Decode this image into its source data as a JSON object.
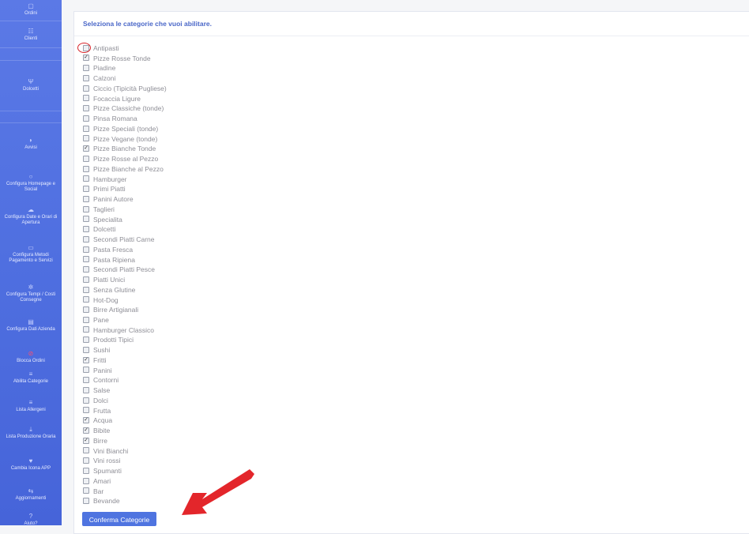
{
  "sidebar": {
    "items": [
      {
        "label": "Ordini",
        "icon": "box-icon"
      },
      {
        "label": "Clienti",
        "icon": "users-icon"
      },
      {
        "label": "Dolcetti",
        "icon": "fork-knife-icon"
      },
      {
        "label": "Avvisi",
        "icon": "megaphone-icon"
      },
      {
        "label": "Configura Homepage e Social",
        "icon": "chat-icon"
      },
      {
        "label": "Configura Date e Orari di Apertura",
        "icon": "cloud-icon"
      },
      {
        "label": "Configura Metodi Pagamento e Servizi",
        "icon": "card-icon"
      },
      {
        "label": "Configura Tempi / Costi Consegne",
        "icon": "gears-icon"
      },
      {
        "label": "Configura Dati Azienda",
        "icon": "building-icon"
      },
      {
        "label": "Blocca Ordini",
        "icon": "stop-icon",
        "color": "#ff4d6d"
      },
      {
        "label": "Abilita Categorie",
        "icon": "list-icon"
      },
      {
        "label": "Lista Allergeni",
        "icon": "list-icon"
      },
      {
        "label": "Lista Produzione Oraria",
        "icon": "download-icon"
      },
      {
        "label": "Cambia Icona APP",
        "icon": "heart-icon"
      },
      {
        "label": "Aggiornamenti",
        "icon": "refresh-icon"
      },
      {
        "label": "Aiuto?",
        "icon": "help-icon"
      }
    ]
  },
  "main": {
    "title": "Seleziona le categorie che vuoi abilitare.",
    "categories": [
      {
        "label": "Antipasti",
        "checked": false
      },
      {
        "label": "Pizze Rosse Tonde",
        "checked": true
      },
      {
        "label": "Piadine",
        "checked": false
      },
      {
        "label": "Calzoni",
        "checked": false
      },
      {
        "label": "Ciccio  (Tipicità Pugliese)",
        "checked": false
      },
      {
        "label": "Focaccia Ligure",
        "checked": false
      },
      {
        "label": "Pizze Classiche (tonde)",
        "checked": false
      },
      {
        "label": "Pinsa Romana",
        "checked": false
      },
      {
        "label": "Pizze Speciali (tonde)",
        "checked": false
      },
      {
        "label": "Pizze Vegane (tonde)",
        "checked": false
      },
      {
        "label": "Pizze Bianche Tonde",
        "checked": true
      },
      {
        "label": "Pizze Rosse al Pezzo",
        "checked": false
      },
      {
        "label": "Pizze Bianche al Pezzo",
        "checked": false
      },
      {
        "label": "Hamburger",
        "checked": false
      },
      {
        "label": "Primi Piatti",
        "checked": false
      },
      {
        "label": "Panini Autore",
        "checked": false
      },
      {
        "label": "Taglieri",
        "checked": false
      },
      {
        "label": "Specialita",
        "checked": false
      },
      {
        "label": "Dolcetti",
        "checked": false
      },
      {
        "label": "Secondi Piatti Carne",
        "checked": false
      },
      {
        "label": "Pasta Fresca",
        "checked": false
      },
      {
        "label": "Pasta Ripiena",
        "checked": false
      },
      {
        "label": "Secondi Piatti Pesce",
        "checked": false
      },
      {
        "label": "Piatti Unici",
        "checked": false
      },
      {
        "label": "Senza Glutine",
        "checked": false
      },
      {
        "label": "Hot-Dog",
        "checked": false
      },
      {
        "label": "Birre Artigianali",
        "checked": false
      },
      {
        "label": "Pane",
        "checked": false
      },
      {
        "label": "Hamburger Classico",
        "checked": false
      },
      {
        "label": "Prodotti Tipici",
        "checked": false
      },
      {
        "label": "Sushi",
        "checked": false
      },
      {
        "label": "Fritti",
        "checked": true
      },
      {
        "label": "Panini",
        "checked": false
      },
      {
        "label": "Contorni",
        "checked": false
      },
      {
        "label": "Salse",
        "checked": false
      },
      {
        "label": "Dolci",
        "checked": false
      },
      {
        "label": "Frutta",
        "checked": false
      },
      {
        "label": "Acqua",
        "checked": true
      },
      {
        "label": "Bibite",
        "checked": true
      },
      {
        "label": "Birre",
        "checked": true
      },
      {
        "label": "Vini Bianchi",
        "checked": false
      },
      {
        "label": "Vini rossi",
        "checked": false
      },
      {
        "label": "Spumanti",
        "checked": false
      },
      {
        "label": "Amari",
        "checked": false
      },
      {
        "label": "Bar",
        "checked": false
      },
      {
        "label": "Bevande",
        "checked": false
      }
    ],
    "confirm_label": "Conferma Categorie"
  },
  "colors": {
    "sidebar": "#5273e2",
    "accent": "#4a67c8",
    "button": "#4f74e0",
    "annotation_red": "#e3262b"
  }
}
